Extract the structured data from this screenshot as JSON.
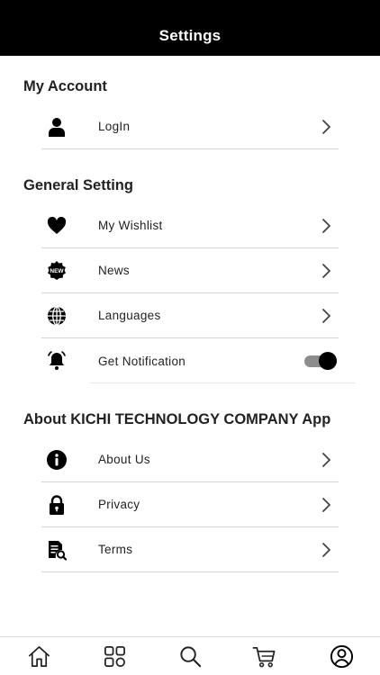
{
  "header": {
    "title": "Settings"
  },
  "sections": {
    "account": {
      "title": "My Account"
    },
    "general": {
      "title": "General Setting"
    },
    "about": {
      "title": "About KICHI TECHNOLOGY COMPANY App"
    }
  },
  "account_items": [
    {
      "label": "LogIn",
      "icon": "user-icon"
    }
  ],
  "general_items": [
    {
      "label": "My Wishlist",
      "icon": "heart-icon"
    },
    {
      "label": "News",
      "icon": "new-badge-icon"
    },
    {
      "label": "Languages",
      "icon": "globe-icon"
    },
    {
      "label": "Get Notification",
      "icon": "bell-icon",
      "toggle_on": true
    }
  ],
  "about_items": [
    {
      "label": "About Us",
      "icon": "info-icon"
    },
    {
      "label": "Privacy",
      "icon": "lock-icon"
    },
    {
      "label": "Terms",
      "icon": "document-search-icon"
    }
  ],
  "tabbar": [
    {
      "icon": "home-icon"
    },
    {
      "icon": "categories-icon"
    },
    {
      "icon": "search-icon"
    },
    {
      "icon": "cart-icon"
    },
    {
      "icon": "profile-icon",
      "active": true
    }
  ],
  "badge": {
    "new_text": "NEW"
  },
  "colors": {
    "header_bg": "#000000",
    "toggle_track": "#8c8c8c",
    "toggle_knob": "#000000",
    "divider": "#d6d6d6"
  }
}
